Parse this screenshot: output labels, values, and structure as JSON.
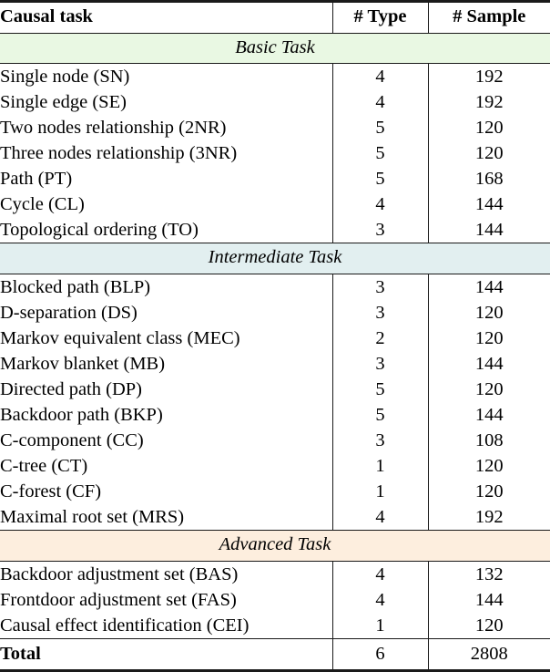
{
  "table": {
    "columns": {
      "task": "Causal task",
      "type": "# Type",
      "sample": "# Sample"
    },
    "sections": [
      {
        "title": "Basic Task",
        "rows": [
          {
            "task": "Single node (SN)",
            "type": "4",
            "sample": "192"
          },
          {
            "task": "Single edge (SE)",
            "type": "4",
            "sample": "192"
          },
          {
            "task": "Two nodes relationship (2NR)",
            "type": "5",
            "sample": "120"
          },
          {
            "task": "Three nodes relationship (3NR)",
            "type": "5",
            "sample": "120"
          },
          {
            "task": "Path (PT)",
            "type": "5",
            "sample": "168"
          },
          {
            "task": "Cycle (CL)",
            "type": "4",
            "sample": "144"
          },
          {
            "task": "Topological ordering (TO)",
            "type": "3",
            "sample": "144"
          }
        ]
      },
      {
        "title": "Intermediate Task",
        "rows": [
          {
            "task": "Blocked path (BLP)",
            "type": "3",
            "sample": "144"
          },
          {
            "task": "D-separation (DS)",
            "type": "3",
            "sample": "120"
          },
          {
            "task": "Markov equivalent class (MEC)",
            "type": "2",
            "sample": "120"
          },
          {
            "task": "Markov blanket (MB)",
            "type": "3",
            "sample": "144"
          },
          {
            "task": "Directed path (DP)",
            "type": "5",
            "sample": "120"
          },
          {
            "task": "Backdoor path (BKP)",
            "type": "5",
            "sample": "144"
          },
          {
            "task": "C-component (CC)",
            "type": "3",
            "sample": "108"
          },
          {
            "task": "C-tree (CT)",
            "type": "1",
            "sample": "120"
          },
          {
            "task": "C-forest (CF)",
            "type": "1",
            "sample": "120"
          },
          {
            "task": "Maximal root set (MRS)",
            "type": "4",
            "sample": "192"
          }
        ]
      },
      {
        "title": "Advanced Task",
        "rows": [
          {
            "task": "Backdoor adjustment set (BAS)",
            "type": "4",
            "sample": "132"
          },
          {
            "task": "Frontdoor adjustment set (FAS)",
            "type": "4",
            "sample": "144"
          },
          {
            "task": "Causal effect identification (CEI)",
            "type": "1",
            "sample": "120"
          }
        ]
      }
    ],
    "total": {
      "label": "Total",
      "type": "6",
      "sample": "2808"
    },
    "colors": {
      "basic_band": "#e9f8e3",
      "intermediate_band": "#e2eff0",
      "advanced_band": "#fdeede",
      "rule": "#1a1a1a"
    }
  }
}
